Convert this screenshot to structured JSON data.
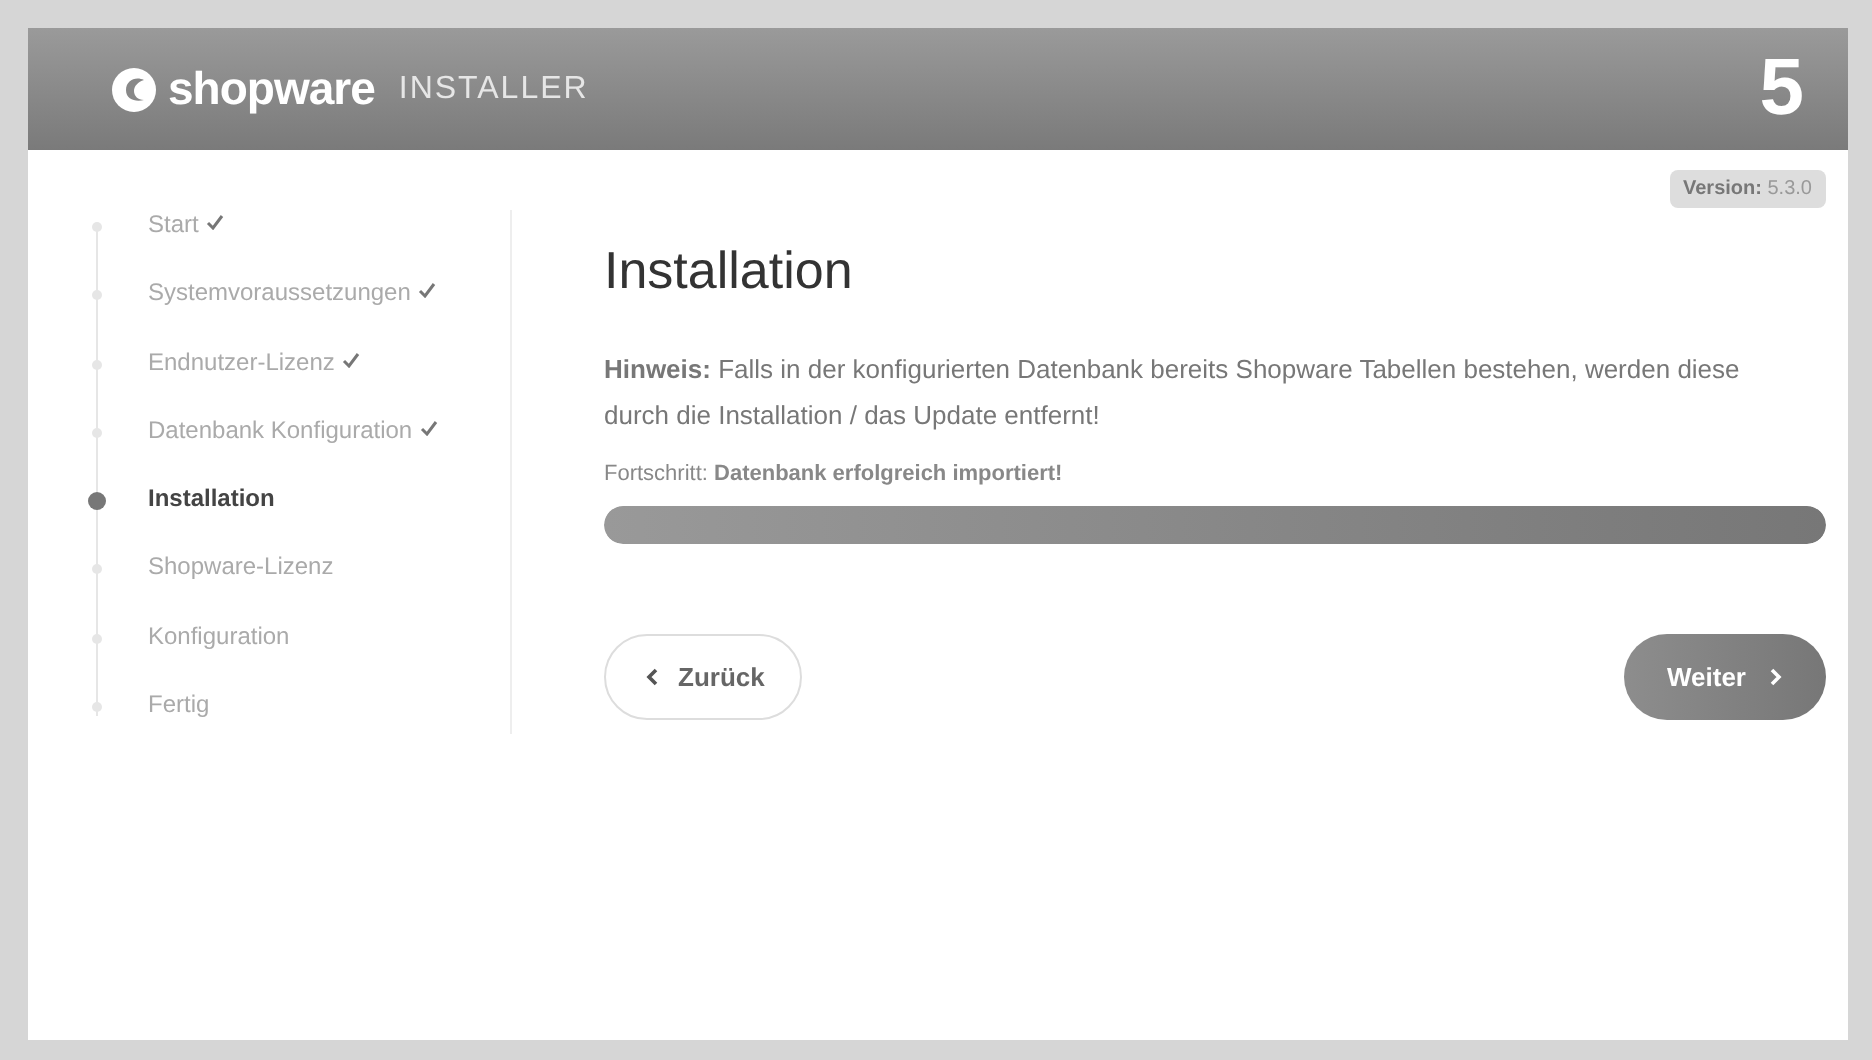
{
  "header": {
    "brand": "shopware",
    "product": "INSTALLER",
    "version_mark": "5"
  },
  "version": {
    "label": "Version:",
    "value": "5.3.0"
  },
  "steps": [
    {
      "label": "Start",
      "done": true,
      "selected": false
    },
    {
      "label": "Systemvoraussetzungen",
      "done": true,
      "selected": false
    },
    {
      "label": "Endnutzer-Lizenz",
      "done": true,
      "selected": false
    },
    {
      "label": "Datenbank Konfiguration",
      "done": true,
      "selected": false
    },
    {
      "label": "Installation",
      "done": false,
      "selected": true
    },
    {
      "label": "Shopware-Lizenz",
      "done": false,
      "selected": false
    },
    {
      "label": "Konfiguration",
      "done": false,
      "selected": false
    },
    {
      "label": "Fertig",
      "done": false,
      "selected": false
    }
  ],
  "title": "Installation",
  "notice": "**Hinweis:** Falls in der konfigurierten Datenbank bereits Shopware Tabellen bestehen, werden diese durch die Installation / das Update entfernt!",
  "progress": {
    "label": "Fortschritt: **Datenbank erfolgreich importiert!**",
    "level": 1
  },
  "buttons": {
    "back": "Zurück",
    "next": "Weiter"
  }
}
